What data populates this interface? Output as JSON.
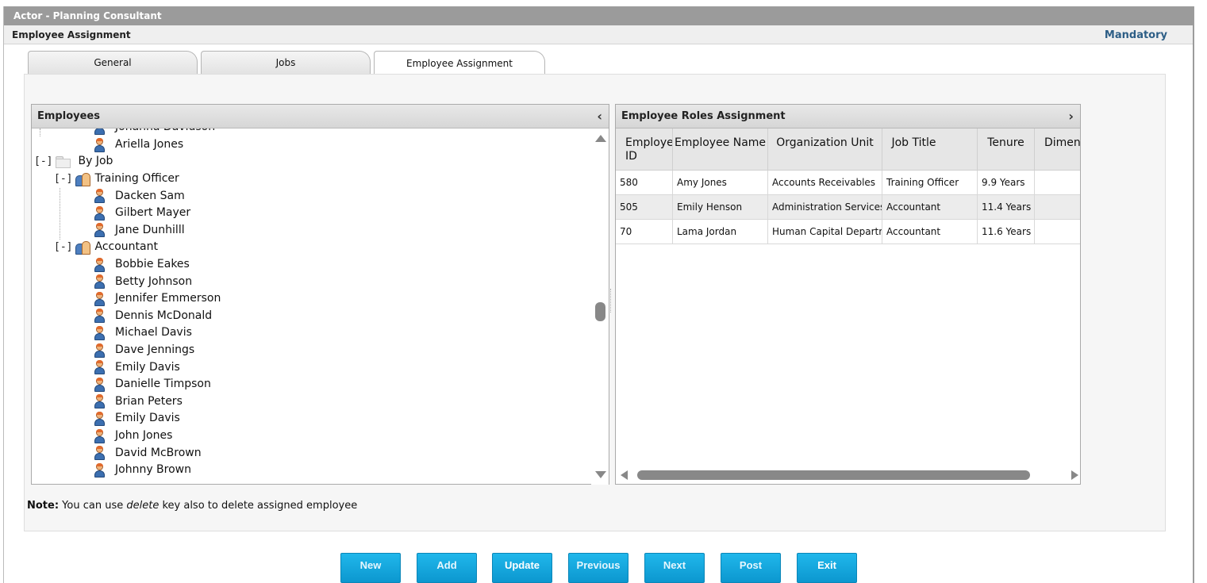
{
  "window": {
    "title": "Actor - Planning Consultant",
    "subtitle": "Employee Assignment",
    "mandatory_label": "Mandatory"
  },
  "tabs": [
    {
      "label": "General",
      "active": false
    },
    {
      "label": "Jobs",
      "active": false
    },
    {
      "label": "Employee Assignment",
      "active": true
    }
  ],
  "employees_panel": {
    "title": "Employees",
    "collapse_glyph": "‹",
    "partial_top_item": "Johanna Davidson",
    "first_item": "Ariella Jones",
    "by_job_toggle": "[-]",
    "by_job_label": "By Job",
    "groups": [
      {
        "toggle": "[-]",
        "label": "Training Officer",
        "members": [
          "Dacken Sam",
          "Gilbert Mayer",
          "Jane Dunhilll"
        ]
      },
      {
        "toggle": "[-]",
        "label": "Accountant",
        "members": [
          "Bobbie Eakes",
          "Betty Johnson",
          "Jennifer Emmerson",
          "Dennis McDonald",
          "Michael Davis",
          "Dave Jennings",
          "Emily Davis",
          "Danielle Timpson",
          "Brian Peters",
          "Emily Davis",
          "John Jones",
          "David McBrown",
          "Johnny Brown"
        ]
      }
    ]
  },
  "roles_panel": {
    "title": "Employee Roles Assignment",
    "expand_glyph": "›",
    "columns": [
      "Employee ID",
      "Employee Name",
      "Organization Unit",
      "Job Title",
      "Tenure",
      "Dimens"
    ],
    "rows": [
      [
        "580",
        "Amy Jones",
        "Accounts Receivables",
        "Training Officer",
        "9.9 Years",
        ""
      ],
      [
        "505",
        "Emily Henson",
        "Administration Services",
        "Accountant",
        "11.4 Years",
        ""
      ],
      [
        "70",
        "Lama Jordan",
        "Human Capital Departm",
        "Accountant",
        "11.6 Years",
        ""
      ]
    ]
  },
  "note": {
    "label": "Note:",
    "text_before": " You can use ",
    "keyword": "delete",
    "text_after": " key also to delete assigned employee"
  },
  "buttons": [
    "New",
    "Add",
    "Update",
    "Previous",
    "Next",
    "Post",
    "Exit"
  ],
  "colors": {
    "title_bar": "#9b9b9b",
    "mandatory": "#2d5e86",
    "button": "#14a7df"
  }
}
